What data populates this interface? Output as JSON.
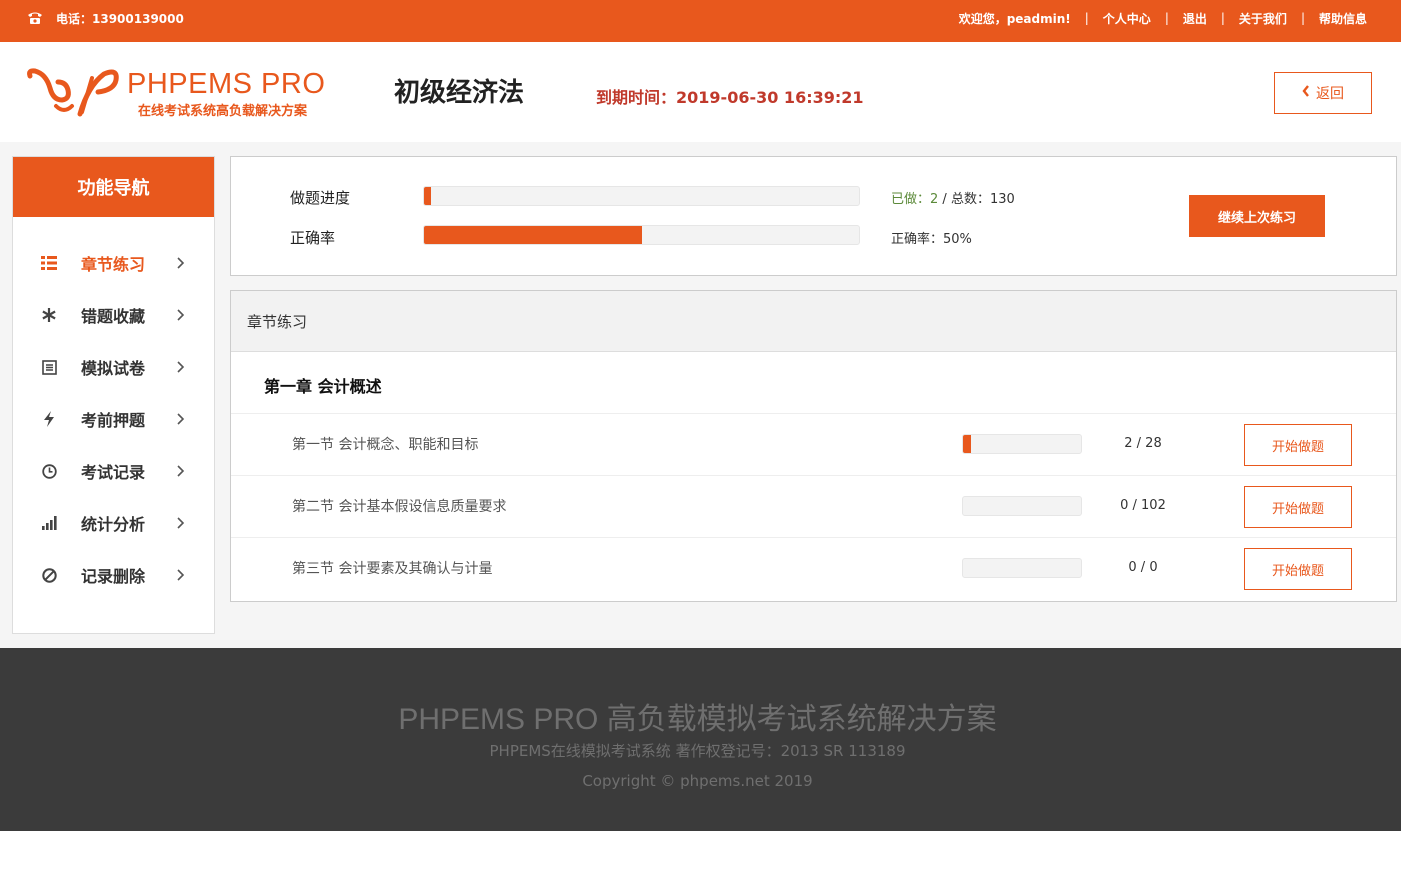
{
  "colors": {
    "accent": "#e8581d",
    "expire": "#c0392b",
    "footer_bg": "#3b3b3b"
  },
  "topbar": {
    "phone_icon": "phone-icon",
    "phone": "电话：13900139000",
    "welcome": "欢迎您，peadmin!",
    "links": [
      "个人中心",
      "退出",
      "关于我们",
      "帮助信息"
    ]
  },
  "header": {
    "logo_name": "PHPEMS PRO",
    "logo_tagline": "在线考试系统高负载解决方案",
    "course_title": "初级经济法",
    "expire_label": "到期时间：",
    "expire_value": "2019-06-30 16:39:21",
    "back_label": "返回"
  },
  "sidebar": {
    "title": "功能导航",
    "items": [
      {
        "label": "章节练习",
        "icon": "list-icon",
        "active": true
      },
      {
        "label": "错题收藏",
        "icon": "asterisk-icon",
        "active": false
      },
      {
        "label": "模拟试卷",
        "icon": "paper-icon",
        "active": false
      },
      {
        "label": "考前押题",
        "icon": "bolt-icon",
        "active": false
      },
      {
        "label": "考试记录",
        "icon": "clock-icon",
        "active": false
      },
      {
        "label": "统计分析",
        "icon": "bar-chart-icon",
        "active": false
      },
      {
        "label": "记录删除",
        "icon": "ban-icon",
        "active": false
      }
    ]
  },
  "progress": {
    "done_label": "做题进度",
    "done_fraction": 0.015,
    "done_prefix": "已做：",
    "done_count": "2",
    "total_sep": " / 总数：",
    "total_count": "130",
    "accuracy_label": "正确率",
    "accuracy_fraction": 0.5,
    "accuracy_text": "正确率：50%",
    "continue_label": "继续上次练习"
  },
  "chapters": {
    "panel_title": "章节练习",
    "chapter_title": "第一章 会计概述",
    "sections": [
      {
        "name": "第一节 会计概念、职能和目标",
        "fraction": 0.071,
        "count": "2 / 28",
        "button": "开始做题"
      },
      {
        "name": "第二节 会计基本假设信息质量要求",
        "fraction": 0,
        "count": "0 / 102",
        "button": "开始做题"
      },
      {
        "name": "第三节 会计要素及其确认与计量",
        "fraction": 0,
        "count": "0 / 0",
        "button": "开始做题"
      }
    ]
  },
  "footer": {
    "title": "PHPEMS PRO 高负载模拟考试系统解决方案",
    "copyright_reg": "PHPEMS在线模拟考试系统 著作权登记号：2013 SR 113189",
    "copyright": "Copyright © phpems.net 2019"
  }
}
